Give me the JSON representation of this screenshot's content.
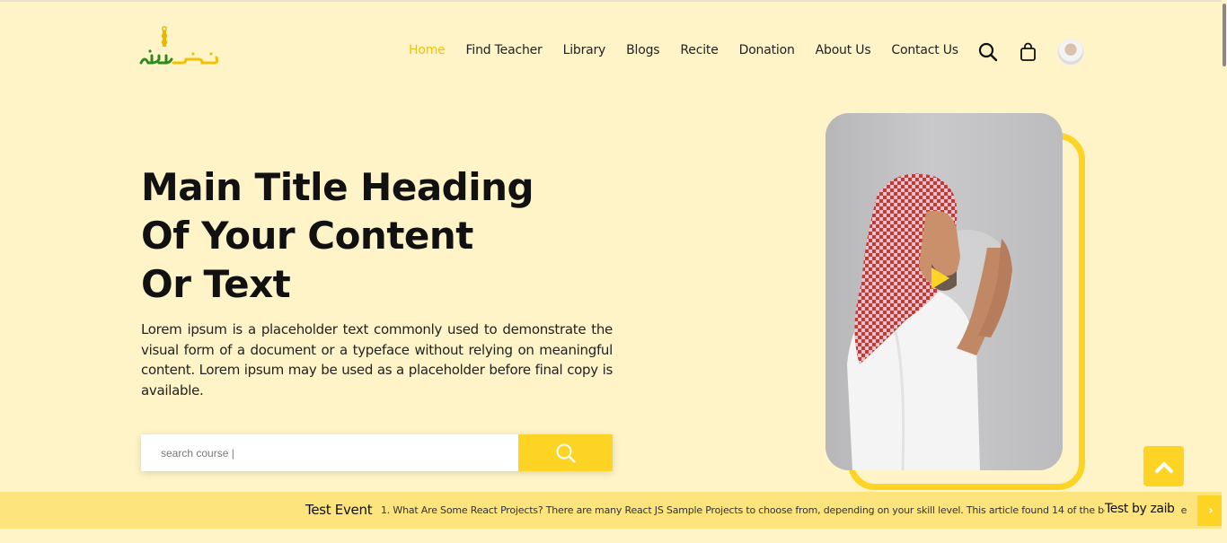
{
  "header": {
    "nav": [
      {
        "label": "Home",
        "active": true
      },
      {
        "label": "Find Teacher"
      },
      {
        "label": "Library"
      },
      {
        "label": "Blogs"
      },
      {
        "label": "Recite"
      },
      {
        "label": "Donation"
      },
      {
        "label": "About Us"
      },
      {
        "label": "Contact Us"
      }
    ],
    "icons": [
      "search-icon",
      "shopping-bag-icon",
      "avatar"
    ]
  },
  "hero": {
    "title_lines": [
      "Main Title Heading",
      "Of Your Content",
      "Or Text"
    ],
    "description": "Lorem ipsum is a placeholder text commonly used to demonstrate the visual form of a document or a typeface without relying on meaningful content. Lorem ipsum may be used as a placeholder before final copy is available.",
    "search": {
      "placeholder": "search course |"
    }
  },
  "ticker": {
    "label": "Test Event",
    "text": "1. What Are Some React Projects? There are many React JS Sample Projects to choose from, depending on your skill level. This article found 14 of the best React JS Proje",
    "author": "Test by zaib"
  },
  "colors": {
    "background": "#fff4c8",
    "accent": "#fdd424",
    "ticker_bg": "#fde47c",
    "logo_green": "#2e7d1e"
  }
}
